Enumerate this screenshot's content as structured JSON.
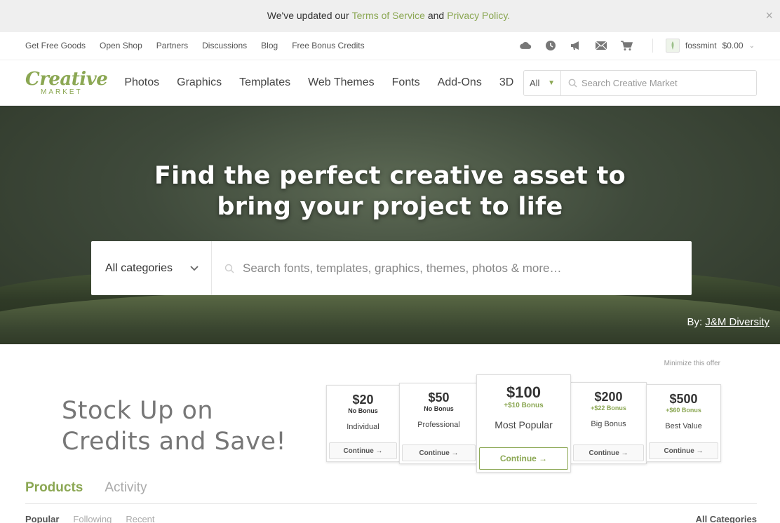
{
  "notice": {
    "text_before": "We've updated our",
    "terms_link": "Terms of Service",
    "and": "and",
    "privacy_link": "Privacy Policy.",
    "close": "×"
  },
  "utility": {
    "links": [
      "Get Free Goods",
      "Open Shop",
      "Partners",
      "Discussions",
      "Blog",
      "Free Bonus Credits"
    ],
    "username": "fossmint",
    "balance": "$0.00"
  },
  "logo": {
    "line1": "Creative",
    "line2": "MARKET"
  },
  "nav": {
    "items": [
      "Photos",
      "Graphics",
      "Templates",
      "Web Themes",
      "Fonts",
      "Add-Ons",
      "3D"
    ],
    "search_scope": "All",
    "search_placeholder": "Search Creative Market"
  },
  "hero": {
    "headline_line1": "Find the perfect creative asset to",
    "headline_line2": "bring your project to life",
    "category_select": "All categories",
    "search_placeholder": "Search fonts, templates, graphics, themes, photos & more…",
    "by_label": "By:",
    "by_author": "J&M Diversity"
  },
  "offer": {
    "minimize": "Minimize this offer",
    "headline_line1": "Stock Up on",
    "headline_line2": "Credits and Save!",
    "cards": [
      {
        "price": "$20",
        "bonus": "No Bonus",
        "tier": "Individual",
        "cta": "Continue →"
      },
      {
        "price": "$50",
        "bonus": "No Bonus",
        "tier": "Professional",
        "cta": "Continue →"
      },
      {
        "price": "$100",
        "bonus": "+$10 Bonus",
        "tier": "Most Popular",
        "cta": "Continue →"
      },
      {
        "price": "$200",
        "bonus": "+$22 Bonus",
        "tier": "Big Bonus",
        "cta": "Continue →"
      },
      {
        "price": "$500",
        "bonus": "+$60 Bonus",
        "tier": "Best Value",
        "cta": "Continue →"
      }
    ]
  },
  "tabs": {
    "products": "Products",
    "activity": "Activity"
  },
  "subtabs": {
    "popular": "Popular",
    "following": "Following",
    "recent": "Recent",
    "all_categories": "All Categories"
  },
  "colors": {
    "accent": "#8ba753"
  }
}
